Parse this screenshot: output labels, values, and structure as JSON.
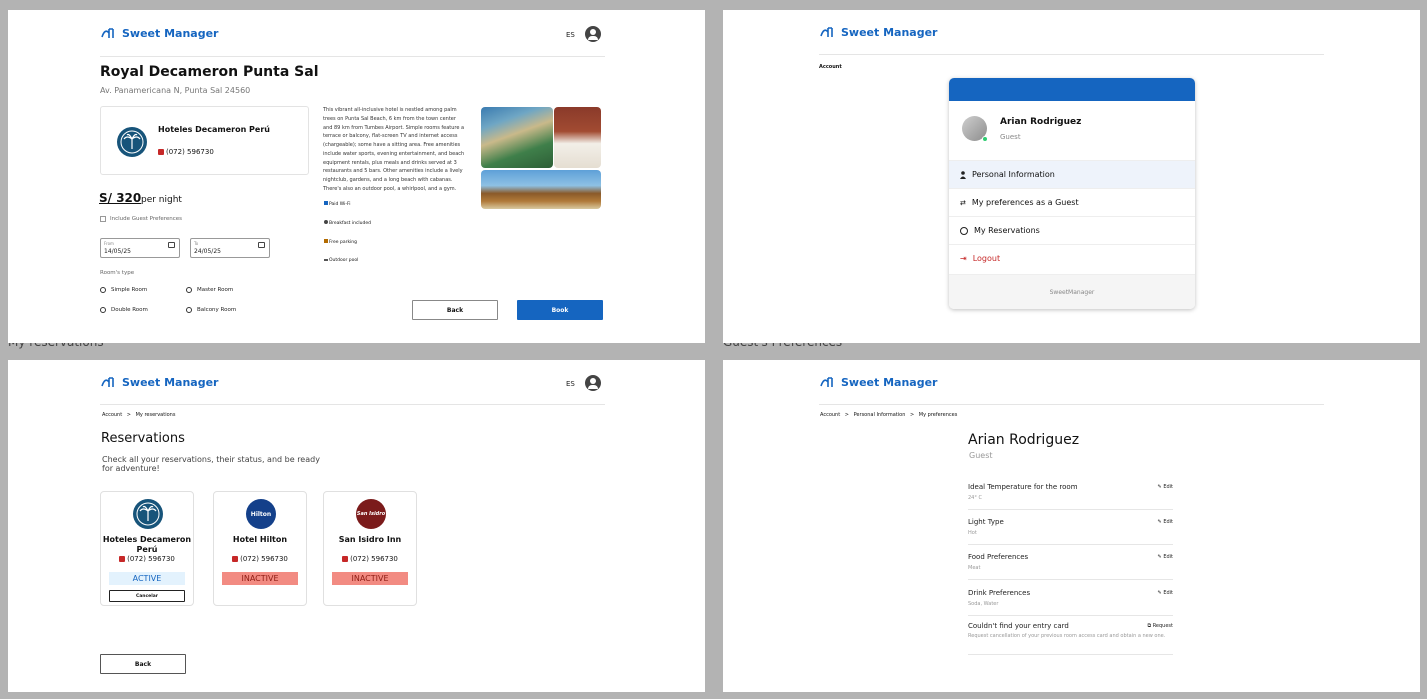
{
  "app": {
    "name": "Sweet Manager",
    "lang": "ES"
  },
  "labels": {
    "my_reservations": "My reservations",
    "guest_prefs": "Guest's Preferences"
  },
  "booking": {
    "hotel_name": "Royal Decameron Punta Sal",
    "address": "Av. Panamericana N, Punta Sal 24560",
    "provider": "Hoteles Decameron Perú",
    "phone": "(072) 596730",
    "price": "S/ 320",
    "per_night": "per night",
    "guest_prefs_checkbox": "Include Guest Preferences",
    "from_label": "From",
    "from_value": "14/05/25",
    "to_label": "To",
    "to_value": "24/05/25",
    "room_type_label": "Room's type",
    "rooms": [
      "Simple Room",
      "Master Room",
      "Double Room",
      "Balcony Room"
    ],
    "description": "This vibrant all-inclusive hotel is nestled among palm trees on Punta Sal Beach, 6 km from the town center and 89 km from Tumbes Airport. Simple rooms feature a terrace or balcony, flat-screen TV and internet access (chargeable); some have a sitting area. Free amenities include water sports, evening entertainment, and beach equipment rentals, plus meals and drinks served at 3 restaurants and 5 bars. Other amenities include a lively nightclub, gardens, and a long beach with cabanas. There's also an outdoor pool, a whirlpool, and a gym.",
    "amenities": [
      "Paid Wi-Fi",
      "Breakfast included",
      "Free parking",
      "Outdoor pool"
    ],
    "back": "Back",
    "book": "Book"
  },
  "account": {
    "breadcrumb": "Account",
    "name": "Arian Rodriguez",
    "role": "Guest",
    "menu": [
      "Personal Information",
      "My preferences as a Guest",
      "My Reservations",
      "Logout"
    ],
    "footer": "SweetManager"
  },
  "reservations": {
    "crumb_account": "Account",
    "crumb_sep": ">",
    "crumb_current": "My reservations",
    "title": "Reservations",
    "subtitle": "Check all your reservations, their status, and be ready for adventure!",
    "cards": [
      {
        "name": "Hoteles Decameron Perú",
        "phone": "(072) 596730",
        "status": "ACTIVE",
        "action": "Cancelar"
      },
      {
        "name": "Hotel Hilton",
        "phone": "(072) 596730",
        "status": "INACTIVE",
        "logo_text": "Hilton"
      },
      {
        "name": "San Isidro Inn",
        "phone": "(072) 596730",
        "status": "INACTIVE",
        "logo_text": "San Isidro"
      }
    ],
    "back": "Back"
  },
  "preferences": {
    "crumbs": [
      "Account",
      ">",
      "Personal Information",
      ">",
      "My preferences"
    ],
    "name": "Arian Rodriguez",
    "role": "Guest",
    "items": [
      {
        "title": "Ideal Temperature for the room",
        "value": "24° C",
        "action": "Edit"
      },
      {
        "title": "Light Type",
        "value": "Hot",
        "action": "Edit"
      },
      {
        "title": "Food Preferences",
        "value": "Meat",
        "action": "Edit"
      },
      {
        "title": "Drink Preferences",
        "value": "Soda, Water",
        "action": "Edit"
      },
      {
        "title": "Couldn't find your entry card",
        "value": "Request cancellation of your previous room access card and obtain a new one.",
        "action": "Request"
      }
    ]
  },
  "colors": {
    "brand": "#1565c0",
    "active_bg": "#e3f2fd",
    "inactive_bg": "#f28b82",
    "logout": "#c62828"
  }
}
